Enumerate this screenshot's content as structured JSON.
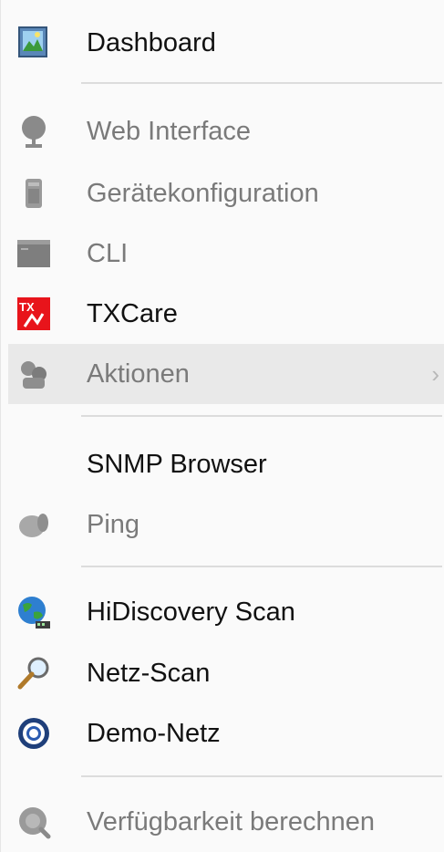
{
  "menu": {
    "items": [
      {
        "label": "Dashboard"
      },
      {
        "label": "Web Interface"
      },
      {
        "label": "Gerätekonfiguration"
      },
      {
        "label": "CLI"
      },
      {
        "label": "TXCare"
      },
      {
        "label": "Aktionen",
        "submenu_arrow": "›"
      },
      {
        "label": "SNMP Browser"
      },
      {
        "label": "Ping"
      },
      {
        "label": "HiDiscovery Scan"
      },
      {
        "label": "Netz-Scan"
      },
      {
        "label": "Demo-Netz"
      },
      {
        "label": "Verfügbarkeit berechnen"
      }
    ],
    "txcare_icon_text": "TX",
    "colors": {
      "text": "#111111",
      "disabled_text": "#7a7a7a",
      "hover_background": "#e9e9e9",
      "separator": "#dcdcdc",
      "txcare_red": "#e8141b"
    }
  }
}
